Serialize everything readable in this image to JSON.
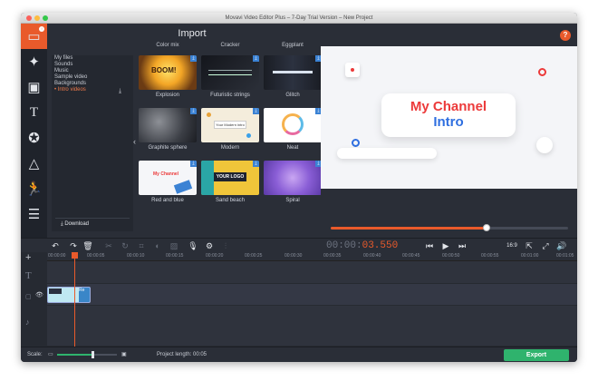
{
  "window": {
    "title": "Movavi Video Editor Plus – 7-Day Trial Version – New Project"
  },
  "import": {
    "title": "Import",
    "categories": [
      "My files",
      "Sounds",
      "Music",
      "Sample video",
      "Backgrounds",
      "• Intro videos"
    ],
    "download_label": "Download",
    "column_headers": [
      "Color mix",
      "Cracker",
      "Eggplant"
    ],
    "items": [
      {
        "caption": "Explosion"
      },
      {
        "caption": "Futuristic strings"
      },
      {
        "caption": "Glitch"
      },
      {
        "caption": "Graphite sphere"
      },
      {
        "caption": "Modern"
      },
      {
        "caption": "Neat"
      },
      {
        "caption": "Red and blue"
      },
      {
        "caption": "Sand beach"
      },
      {
        "caption": "Spiral"
      }
    ],
    "thumb_texts": {
      "explosion": "BOOM!",
      "modern": "Your Modern intro",
      "red_blue": "My Channel",
      "sand": "YOUR LOGO"
    }
  },
  "preview": {
    "line1": "My Channel",
    "line2": "Intro",
    "progress": 0.65
  },
  "timecode": {
    "dim": "00:00:",
    "active": "03.550"
  },
  "aspect": "16:9",
  "timeline": {
    "ticks": [
      "00:00:00",
      "00:00:05",
      "00:00:10",
      "00:00:15",
      "00:00:20",
      "00:00:25",
      "00:00:30",
      "00:00:35",
      "00:00:40",
      "00:00:45",
      "00:00:50",
      "00:00:55",
      "00:01:00",
      "00:01:05"
    ],
    "clip_label": "Re"
  },
  "status": {
    "scale_label": "Scale:",
    "project_length_label": "Project length:",
    "project_length": "00:05",
    "export_label": "Export"
  },
  "colors": {
    "accent": "#e95a2b",
    "export": "#2fb36d",
    "title_red": "#ec3a3a",
    "title_blue": "#2f6fe0"
  }
}
